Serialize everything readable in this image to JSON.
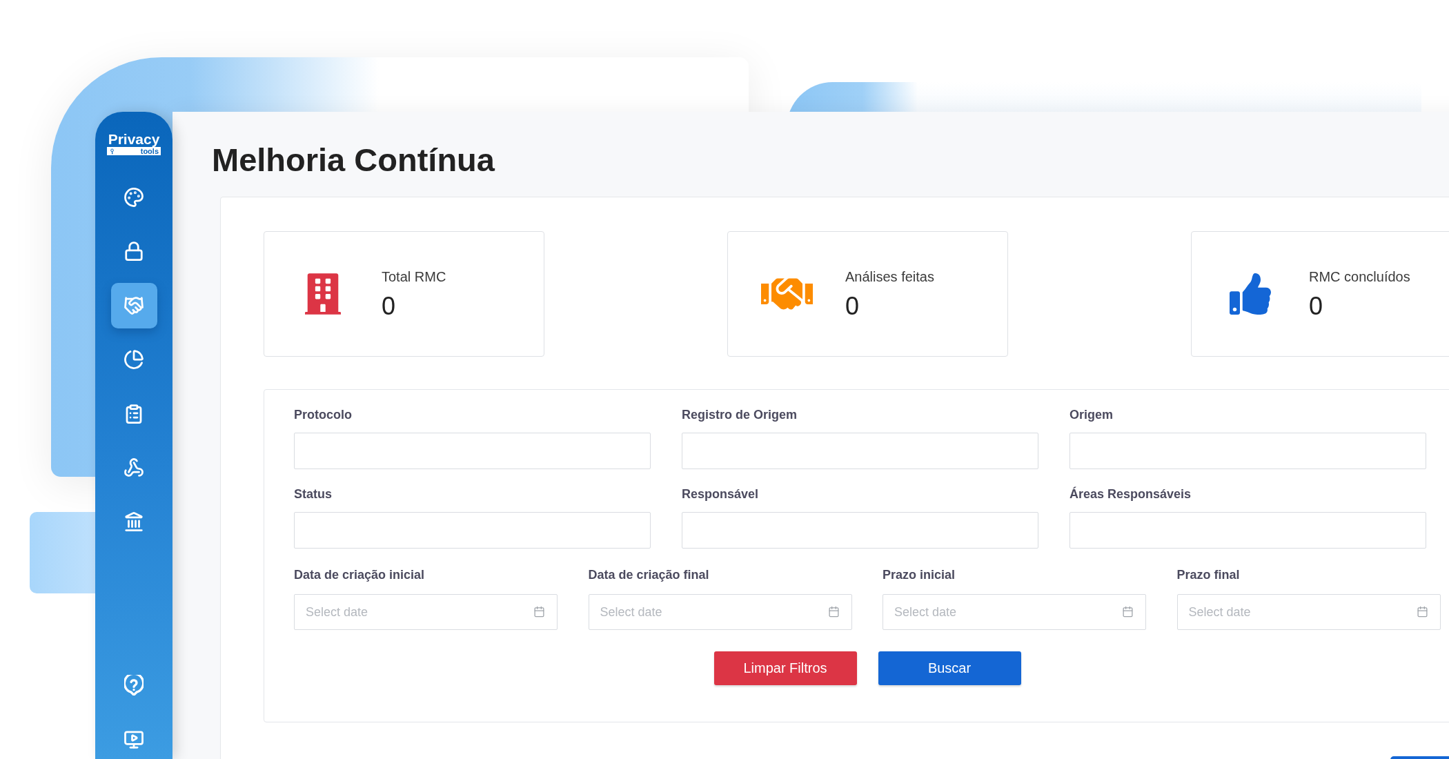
{
  "sidebar": {
    "logo": {
      "title": "Privacy",
      "subtitle": "tools"
    },
    "items": [
      {
        "selected": false
      },
      {
        "selected": false
      },
      {
        "selected": true
      },
      {
        "selected": false
      },
      {
        "selected": false
      },
      {
        "selected": false
      },
      {
        "selected": false
      }
    ],
    "bottom_items": [
      {
        "selected": false
      },
      {
        "selected": false
      }
    ]
  },
  "page": {
    "title": "Melhoria Contínua"
  },
  "stats": [
    {
      "label": "Total RMC",
      "value": "0",
      "color": "#dc3545"
    },
    {
      "label": "Análises feitas",
      "value": "0",
      "color": "#fd8c00"
    },
    {
      "label": "RMC concluídos",
      "value": "0",
      "color": "#1466d6"
    }
  ],
  "filters": {
    "fields": [
      {
        "label": "Protocolo"
      },
      {
        "label": "Registro de Origem"
      },
      {
        "label": "Origem"
      },
      {
        "label": "Status"
      },
      {
        "label": "Responsável"
      },
      {
        "label": "Áreas Responsáveis"
      }
    ],
    "date_fields": [
      {
        "label": "Data de criação inicial",
        "placeholder": "Select date"
      },
      {
        "label": "Data de criação final",
        "placeholder": "Select date"
      },
      {
        "label": "Prazo inicial",
        "placeholder": "Select date"
      },
      {
        "label": "Prazo final",
        "placeholder": "Select date"
      }
    ],
    "buttons": [
      {
        "label": "Limpar Filtros",
        "kind": "danger"
      },
      {
        "label": "Buscar",
        "kind": "primary"
      }
    ]
  }
}
